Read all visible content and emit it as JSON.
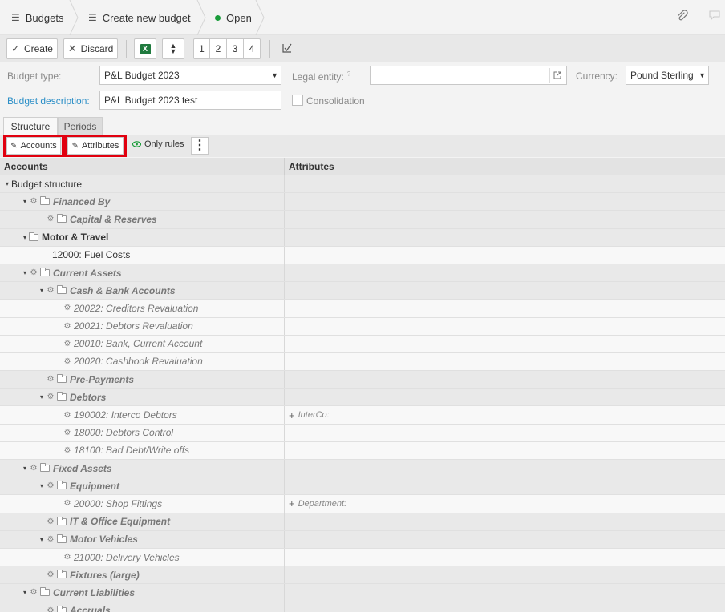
{
  "breadcrumb": {
    "items": [
      {
        "label": "Budgets"
      },
      {
        "label": "Create new budget"
      },
      {
        "label": "Open"
      }
    ]
  },
  "toolbar": {
    "create_label": "Create",
    "discard_label": "Discard",
    "page_buttons": [
      "1",
      "2",
      "3",
      "4"
    ]
  },
  "form": {
    "budget_type_label": "Budget type:",
    "budget_type_value": "P&L Budget 2023",
    "legal_entity_label": "Legal entity:",
    "legal_entity_value": "",
    "currency_label": "Currency:",
    "currency_value": "Pound Sterling",
    "budget_description_label": "Budget description:",
    "budget_description_value": "P&L Budget 2023 test",
    "consolidation_label": "Consolidation"
  },
  "tabs": [
    {
      "label": "Structure",
      "active": true
    },
    {
      "label": "Periods",
      "active": false
    }
  ],
  "subtoolbar": {
    "accounts_label": "Accounts",
    "attributes_label": "Attributes",
    "only_rules_label": "Only rules"
  },
  "table": {
    "headers": {
      "accounts": "Accounts",
      "attributes": "Attributes"
    },
    "rows": [
      {
        "indent": 0,
        "toggle": "▾",
        "gear": false,
        "folder": false,
        "label": "Budget structure",
        "style": "n",
        "bg": "grey",
        "attr": ""
      },
      {
        "indent": 1,
        "toggle": "▾",
        "gear": true,
        "folder": true,
        "label": "Financed By",
        "style": "bit",
        "bg": "grey",
        "attr": ""
      },
      {
        "indent": 2,
        "toggle": "",
        "gear": true,
        "folder": true,
        "label": "Capital & Reserves",
        "style": "bit",
        "bg": "grey",
        "attr": ""
      },
      {
        "indent": 1,
        "toggle": "▾",
        "gear": false,
        "folder": true,
        "label": "Motor & Travel",
        "style": "b",
        "bg": "grey",
        "attr": ""
      },
      {
        "indent": 2,
        "toggle": "",
        "gear": false,
        "folder": false,
        "label": "12000: Fuel Costs",
        "style": "n",
        "bg": "light",
        "attr": ""
      },
      {
        "indent": 1,
        "toggle": "▾",
        "gear": true,
        "folder": true,
        "label": "Current Assets",
        "style": "bit",
        "bg": "grey",
        "attr": ""
      },
      {
        "indent": 2,
        "toggle": "▾",
        "gear": true,
        "folder": true,
        "label": "Cash & Bank Accounts",
        "style": "bit",
        "bg": "grey",
        "attr": ""
      },
      {
        "indent": 3,
        "toggle": "",
        "gear": true,
        "folder": false,
        "label": "20022: Creditors Revaluation",
        "style": "it",
        "bg": "light",
        "attr": ""
      },
      {
        "indent": 3,
        "toggle": "",
        "gear": true,
        "folder": false,
        "label": "20021: Debtors Revaluation",
        "style": "it",
        "bg": "light",
        "attr": ""
      },
      {
        "indent": 3,
        "toggle": "",
        "gear": true,
        "folder": false,
        "label": "20010: Bank, Current Account",
        "style": "it",
        "bg": "light",
        "attr": ""
      },
      {
        "indent": 3,
        "toggle": "",
        "gear": true,
        "folder": false,
        "label": "20020: Cashbook Revaluation",
        "style": "it",
        "bg": "light",
        "attr": ""
      },
      {
        "indent": 2,
        "toggle": "",
        "gear": true,
        "folder": true,
        "label": "Pre-Payments",
        "style": "bit",
        "bg": "grey",
        "attr": ""
      },
      {
        "indent": 2,
        "toggle": "▾",
        "gear": true,
        "folder": true,
        "label": "Debtors",
        "style": "bit",
        "bg": "grey",
        "attr": ""
      },
      {
        "indent": 3,
        "toggle": "",
        "gear": true,
        "folder": false,
        "label": "190002: Interco Debtors",
        "style": "it",
        "bg": "light",
        "attr": "InterCo:"
      },
      {
        "indent": 3,
        "toggle": "",
        "gear": true,
        "folder": false,
        "label": "18000: Debtors Control",
        "style": "it",
        "bg": "light",
        "attr": ""
      },
      {
        "indent": 3,
        "toggle": "",
        "gear": true,
        "folder": false,
        "label": "18100: Bad Debt/Write offs",
        "style": "it",
        "bg": "light",
        "attr": ""
      },
      {
        "indent": 1,
        "toggle": "▾",
        "gear": true,
        "folder": true,
        "label": "Fixed Assets",
        "style": "bit",
        "bg": "grey",
        "attr": ""
      },
      {
        "indent": 2,
        "toggle": "▾",
        "gear": true,
        "folder": true,
        "label": "Equipment",
        "style": "bit",
        "bg": "grey",
        "attr": ""
      },
      {
        "indent": 3,
        "toggle": "",
        "gear": true,
        "folder": false,
        "label": "20000: Shop Fittings",
        "style": "it",
        "bg": "light",
        "attr": "Department:"
      },
      {
        "indent": 2,
        "toggle": "",
        "gear": true,
        "folder": true,
        "label": "IT & Office Equipment",
        "style": "bit",
        "bg": "grey",
        "attr": ""
      },
      {
        "indent": 2,
        "toggle": "▾",
        "gear": true,
        "folder": true,
        "label": "Motor Vehicles",
        "style": "bit",
        "bg": "grey",
        "attr": ""
      },
      {
        "indent": 3,
        "toggle": "",
        "gear": true,
        "folder": false,
        "label": "21000: Delivery Vehicles",
        "style": "it",
        "bg": "light",
        "attr": ""
      },
      {
        "indent": 2,
        "toggle": "",
        "gear": true,
        "folder": true,
        "label": "Fixtures (large)",
        "style": "bit",
        "bg": "grey",
        "attr": ""
      },
      {
        "indent": 1,
        "toggle": "▾",
        "gear": true,
        "folder": true,
        "label": "Current Liabilities",
        "style": "bit",
        "bg": "grey",
        "attr": ""
      },
      {
        "indent": 2,
        "toggle": "",
        "gear": true,
        "folder": true,
        "label": "Accruals",
        "style": "bit",
        "bg": "grey",
        "attr": ""
      }
    ]
  },
  "colors": {
    "accent_link": "#2c8fc7",
    "status_open": "#1a9c3a",
    "highlight_red": "#e1000f"
  }
}
